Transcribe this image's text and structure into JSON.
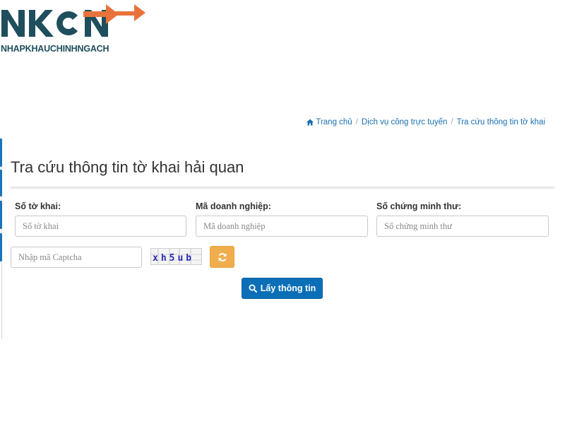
{
  "logo": {
    "wordmark": "NKCN",
    "tagline": "NHAPKHAUCHINHNGACH",
    "colors": {
      "wordmark": "#1f4e5c",
      "arrow": "#e8733a"
    }
  },
  "breadcrumb": {
    "items": [
      "Trang chủ",
      "Dịch vụ công trực tuyến",
      "Tra cứu thông tin tờ khai"
    ]
  },
  "page": {
    "title": "Tra cứu thông tin tờ khai hải quan"
  },
  "form": {
    "fields": [
      {
        "label": "Số tờ khai:",
        "placeholder": "Số tờ khai",
        "value": ""
      },
      {
        "label": "Mã doanh nghiệp:",
        "placeholder": "Mã doanh nghiệp",
        "value": ""
      },
      {
        "label": "Số chứng minh thư:",
        "placeholder": "Số chứng minh thư",
        "value": ""
      }
    ],
    "captcha": {
      "placeholder": "Nhập mã Captcha",
      "value": "",
      "image_text": "xh5ub"
    },
    "submit_label": "Lấy thông tin"
  },
  "icons": {
    "home": "home-icon",
    "refresh": "refresh-icon",
    "search": "search-icon"
  },
  "colors": {
    "link": "#1a6fb0",
    "primary_button": "#0b6fb8",
    "refresh_button": "#f0ad4e"
  }
}
